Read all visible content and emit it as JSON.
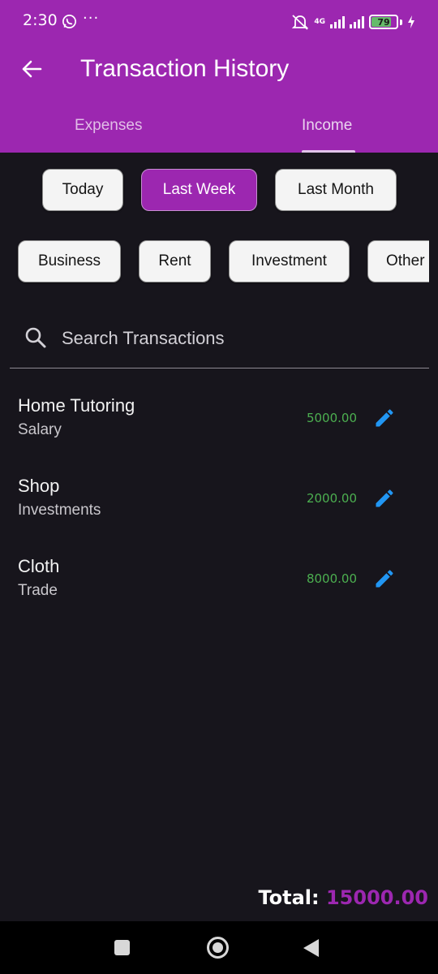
{
  "status_bar": {
    "time": "2:30",
    "overflow": "···",
    "network": "4G",
    "battery": "79",
    "icons": [
      "whatsapp-icon",
      "mute-icon",
      "signal-icon",
      "battery-icon",
      "charging-icon"
    ]
  },
  "app_bar": {
    "title": "Transaction History",
    "back_icon": "arrow-left-icon",
    "color": "#9c27b0"
  },
  "tabs": [
    {
      "label": "Expenses",
      "selected": false
    },
    {
      "label": "Income",
      "selected": true
    }
  ],
  "period_filters": [
    {
      "label": "Today",
      "selected": false
    },
    {
      "label": "Last Week",
      "selected": true
    },
    {
      "label": "Last Month",
      "selected": false
    }
  ],
  "category_filters": [
    {
      "label": "Business"
    },
    {
      "label": "Rent"
    },
    {
      "label": "Investment"
    },
    {
      "label": "Other"
    }
  ],
  "search": {
    "placeholder": "Search Transactions",
    "value": ""
  },
  "transactions": [
    {
      "name": "Home Tutoring",
      "category": "Salary",
      "amount": "5000.00"
    },
    {
      "name": "Shop",
      "category": "Investments",
      "amount": "2000.00"
    },
    {
      "name": "Cloth",
      "category": "Trade",
      "amount": "8000.00"
    }
  ],
  "total": {
    "label": "Total: ",
    "value": "15000.00"
  },
  "colors": {
    "accent": "#9c27b0",
    "amount": "#4caf50",
    "edit_icon": "#2196f3",
    "background": "#17151c"
  }
}
